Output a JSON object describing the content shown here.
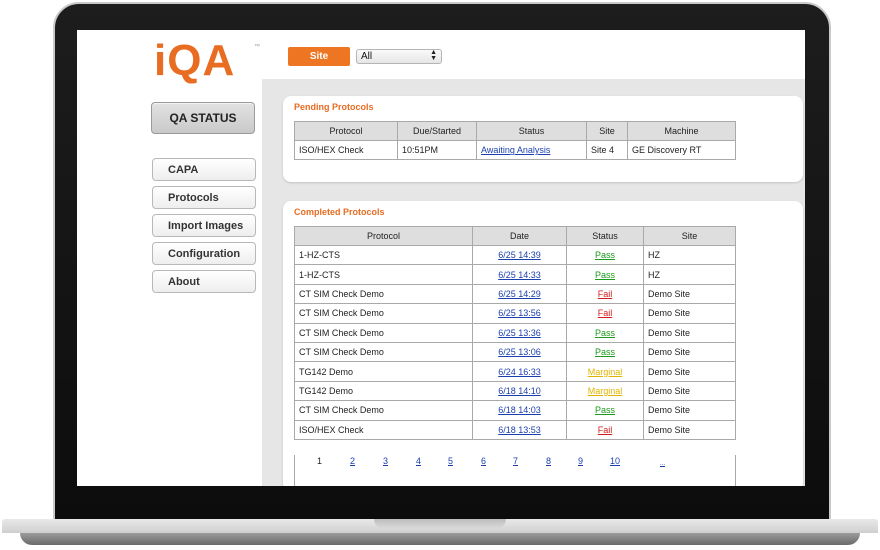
{
  "app": {
    "logo": "iQA",
    "logo_tm": "™"
  },
  "nav": {
    "status_label": "QA STATUS",
    "items": [
      {
        "label": "CAPA"
      },
      {
        "label": "Protocols"
      },
      {
        "label": "Import Images"
      },
      {
        "label": "Configuration"
      },
      {
        "label": "About"
      }
    ]
  },
  "filter": {
    "site_button": "Site",
    "site_value": "All"
  },
  "pending": {
    "title": "Pending Protocols",
    "headers": [
      "Protocol",
      "Due/Started",
      "Status",
      "Site",
      "Machine"
    ],
    "rows": [
      {
        "protocol": "ISO/HEX Check",
        "due": "10:51PM",
        "status": "Awaiting Analysis",
        "site": "Site 4",
        "machine": "GE Discovery RT"
      }
    ]
  },
  "completed": {
    "title": "Completed Protocols",
    "headers": [
      "Protocol",
      "Date",
      "Status",
      "Site"
    ],
    "rows": [
      {
        "protocol": "1-HZ-CTS",
        "date": "6/25 14:39",
        "status": "Pass",
        "site": "HZ"
      },
      {
        "protocol": "1-HZ-CTS",
        "date": "6/25 14:33",
        "status": "Pass",
        "site": "HZ"
      },
      {
        "protocol": "CT SIM Check Demo",
        "date": "6/25 14:29",
        "status": "Fail",
        "site": "Demo Site"
      },
      {
        "protocol": "CT SIM Check Demo",
        "date": "6/25 13:56",
        "status": "Fail",
        "site": "Demo Site"
      },
      {
        "protocol": "CT SIM Check Demo",
        "date": "6/25 13:36",
        "status": "Pass",
        "site": "Demo Site"
      },
      {
        "protocol": "CT SIM Check Demo",
        "date": "6/25 13:06",
        "status": "Pass",
        "site": "Demo Site"
      },
      {
        "protocol": "TG142 Demo",
        "date": "6/24 16:33",
        "status": "Marginal",
        "site": "Demo Site"
      },
      {
        "protocol": "TG142 Demo",
        "date": "6/18 14:10",
        "status": "Marginal",
        "site": "Demo Site"
      },
      {
        "protocol": "CT SIM Check Demo",
        "date": "6/18 14:03",
        "status": "Pass",
        "site": "Demo Site"
      },
      {
        "protocol": "ISO/HEX Check",
        "date": "6/18 13:53",
        "status": "Fail",
        "site": "Demo Site"
      }
    ],
    "pages": [
      "1",
      "2",
      "3",
      "4",
      "5",
      "6",
      "7",
      "8",
      "9",
      "10",
      "..."
    ],
    "current_page": "1"
  },
  "colors": {
    "accent": "#e86c22",
    "pass": "#1d9a1d",
    "fail": "#d31d1d",
    "marginal": "#e0b300",
    "link": "#1a3fae"
  }
}
